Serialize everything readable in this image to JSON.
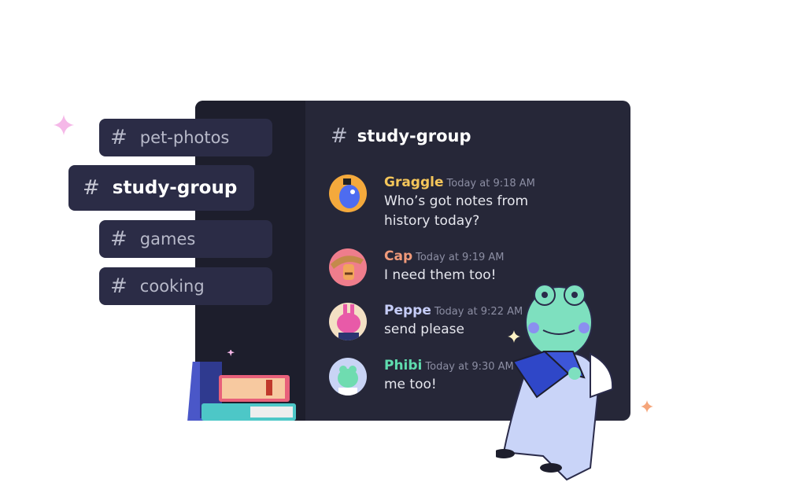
{
  "channels": [
    {
      "label": "pet-photos",
      "active": false
    },
    {
      "label": "study-group",
      "active": true
    },
    {
      "label": "games",
      "active": false
    },
    {
      "label": "cooking",
      "active": false
    }
  ],
  "hash_symbol": "#",
  "header": {
    "title": "study-group"
  },
  "messages": [
    {
      "user": "Graggle",
      "color": "#f5c65a",
      "time": "Today at 9:18 AM",
      "lines": [
        "Who’s got notes from",
        "history today?"
      ],
      "avatar_bg": "#f4a93c"
    },
    {
      "user": "Cap",
      "color": "#f09a7a",
      "time": "Today at 9:19 AM",
      "lines": [
        "I need them too!"
      ],
      "avatar_bg": "#ef7d8c"
    },
    {
      "user": "Peppe",
      "color": "#c6cdf7",
      "time": "Today at 9:22 AM",
      "lines": [
        "send please"
      ],
      "avatar_bg": "#f3e0c4"
    },
    {
      "user": "Phibi",
      "color": "#5fdcae",
      "time": "Today at 9:30 AM",
      "lines": [
        "me too!"
      ],
      "avatar_bg": "#c9d4f5"
    }
  ]
}
